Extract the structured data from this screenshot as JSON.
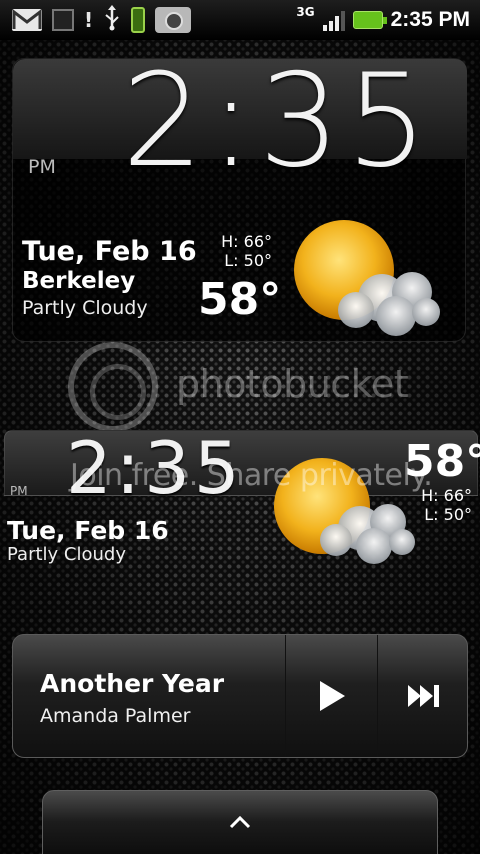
{
  "status_bar": {
    "time": "2:35 PM",
    "network": "3G",
    "icons": [
      "gmail-icon",
      "calendar-icon",
      "alert-icon",
      "usb-icon",
      "phone-icon",
      "camera-icon",
      "signal-icon",
      "battery-icon"
    ],
    "alert_glyph": "!"
  },
  "clock_widget_large": {
    "time": "2:35",
    "ampm": "PM",
    "date": "Tue, Feb 16",
    "city": "Berkeley",
    "condition": "Partly Cloudy",
    "high": "H:  66°",
    "low": "L:  50°",
    "temperature": "58°",
    "weather_icon": "partly-cloudy-icon"
  },
  "watermark": {
    "brand": "photobucket",
    "tagline": "Join free. Share privately."
  },
  "clock_widget_small": {
    "time": "2:35",
    "ampm": "PM",
    "date": "Tue, Feb 16",
    "condition": "Partly Cloudy",
    "temperature": "58°",
    "high": "H:  66°",
    "low": "L:  50°",
    "weather_icon": "partly-cloudy-icon"
  },
  "music_widget": {
    "title": "Another Year",
    "artist": "Amanda Palmer",
    "play_icon": "play-icon",
    "next_icon": "skip-next-icon"
  },
  "app_drawer": {
    "icon": "chevron-up-icon"
  },
  "colors": {
    "battery": "#66c21c",
    "sun": "#f2b21c",
    "background": "#111111"
  }
}
